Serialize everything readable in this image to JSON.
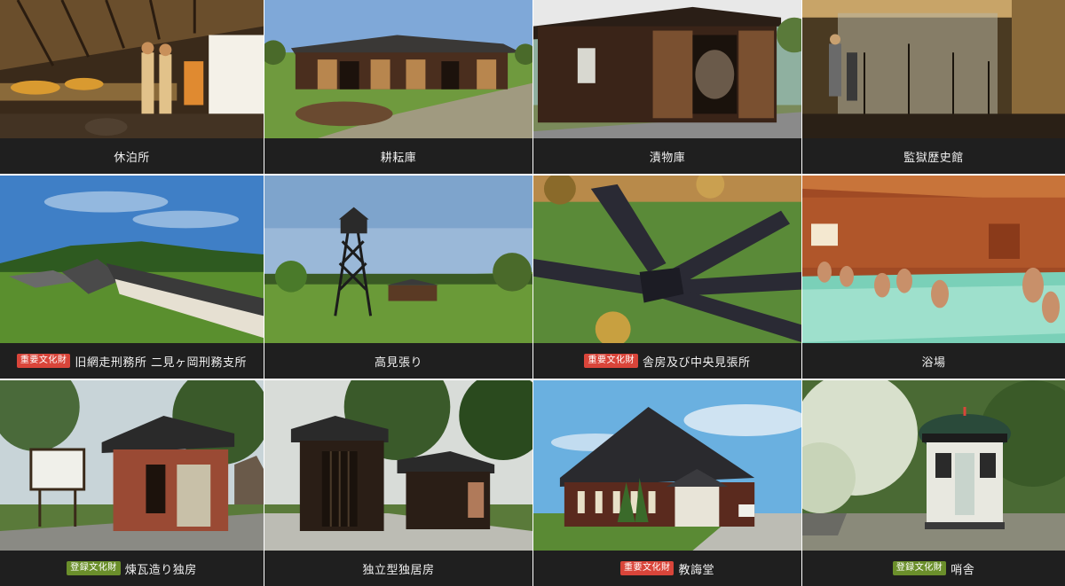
{
  "colors": {
    "important_badge": "#d9453a",
    "registered_badge": "#6b8f2b",
    "caption_bg": "#1f1f1f",
    "caption_text": "#f0f0f0"
  },
  "cards": [
    {
      "title": "休泊所",
      "badge": "",
      "image": "prisoner-lodging-interior"
    },
    {
      "title": "耕耘庫",
      "badge": "",
      "image": "farm-barn"
    },
    {
      "title": "漬物庫",
      "badge": "",
      "image": "pickle-storehouse"
    },
    {
      "title": "監獄歴史館",
      "badge": "",
      "image": "history-museum-interior"
    },
    {
      "title": "旧網走刑務所 二見ヶ岡刑務支所",
      "badge": "重要文化財",
      "image": "futamigaoka-branch-aerial"
    },
    {
      "title": "高見張り",
      "badge": "",
      "image": "watchtower"
    },
    {
      "title": "舎房及び中央見張所",
      "badge": "重要文化財",
      "image": "radial-cell-blocks-aerial"
    },
    {
      "title": "浴場",
      "badge": "",
      "image": "bathhouse-figures"
    },
    {
      "title": "煉瓦造り独房",
      "badge": "登録文化財",
      "image": "brick-solitary-cell"
    },
    {
      "title": "独立型独居房",
      "badge": "",
      "image": "standalone-solitary-cells"
    },
    {
      "title": "教誨堂",
      "badge": "重要文化財",
      "image": "chapel-building"
    },
    {
      "title": "哨舎",
      "badge": "登録文化財",
      "image": "guard-booth"
    }
  ]
}
